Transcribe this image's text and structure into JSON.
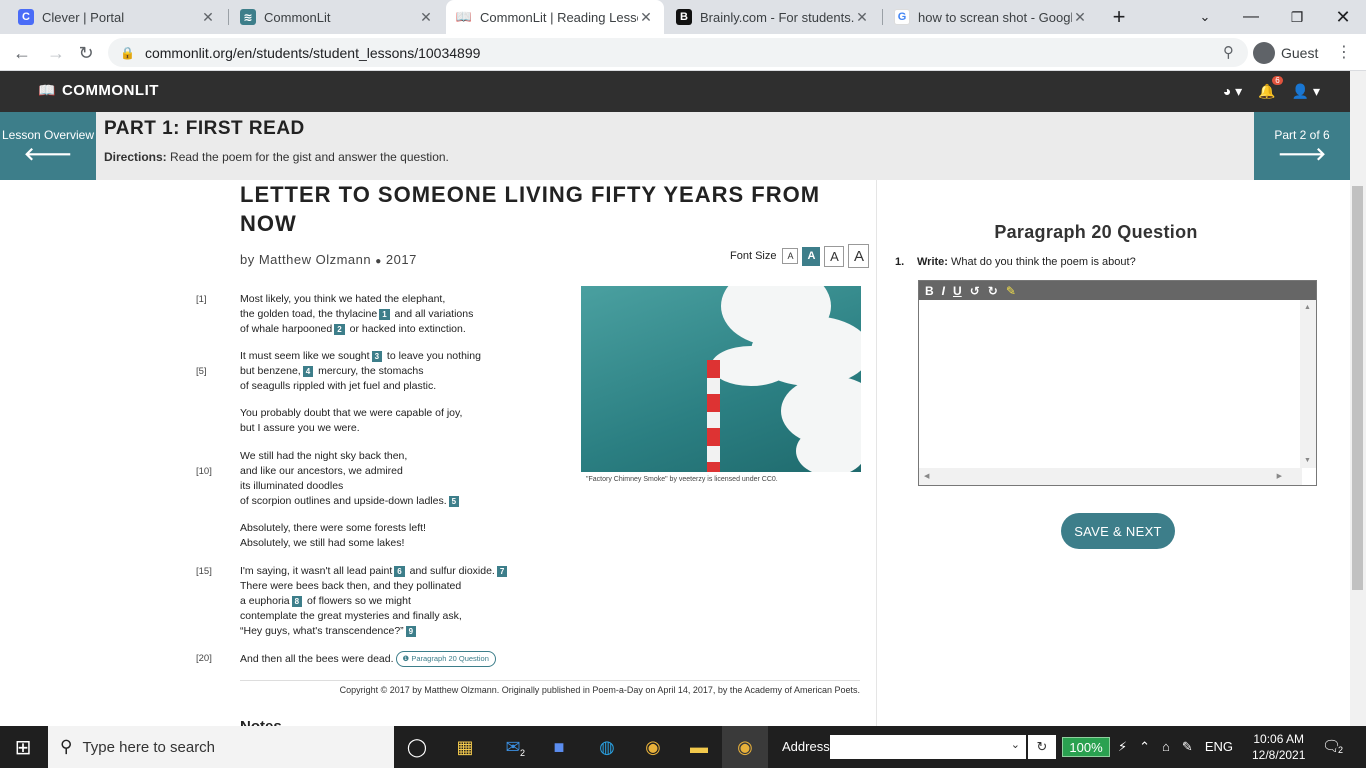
{
  "browser": {
    "tabs": [
      {
        "label": "Clever | Portal",
        "icon": "clever-icon",
        "color": "#4a6cf7"
      },
      {
        "label": "CommonLit",
        "icon": "commonlit-icon",
        "color": "#3d7e8a"
      },
      {
        "label": "CommonLit | Reading Lesson",
        "icon": "book-icon",
        "color": "#202124",
        "active": true
      },
      {
        "label": "Brainly.com - For students. By",
        "icon": "brainly-icon",
        "color": "#111111"
      },
      {
        "label": "how to screan shot - Google S",
        "icon": "google-icon",
        "color": "#4285f4"
      }
    ],
    "url": "commonlit.org/en/students/student_lessons/10034899",
    "profile": "Guest"
  },
  "app": {
    "brand": "COMMONLIT",
    "notification_count": "6"
  },
  "lesson": {
    "overview_label": "Lesson Overview",
    "part_title": "PART 1: FIRST READ",
    "directions_label": "Directions:",
    "directions_text": "Read the poem for the gist and answer the question.",
    "part_progress": "Part 2 of 6"
  },
  "poem": {
    "title": "LETTER TO SOMEONE LIVING FIFTY YEARS FROM NOW",
    "byline": "by Matthew Olzmann",
    "bullet": "●",
    "year": "2017",
    "font_size_label": "Font Size",
    "font_buttons": [
      "A",
      "A",
      "A",
      "A"
    ],
    "line_numbers": [
      "[1]",
      "[5]",
      "[10]",
      "[15]",
      "[20]"
    ],
    "lines": [
      {
        "parts": [
          "Most likely, you think we hated the elephant,"
        ]
      },
      {
        "parts": [
          "the golden toad, the thylacine",
          " and all variations"
        ],
        "fn": [
          "1"
        ]
      },
      {
        "parts": [
          "of whale harpooned",
          " or hacked into extinction."
        ],
        "fn": [
          "2"
        ]
      },
      {
        "parts": [
          "It must seem like we sought",
          " to leave you nothing"
        ],
        "fn": [
          "3"
        ]
      },
      {
        "parts": [
          "but benzene,",
          " mercury, the stomachs"
        ],
        "fn": [
          "4"
        ]
      },
      {
        "parts": [
          "of seagulls rippled with jet fuel and plastic."
        ]
      },
      {
        "parts": [
          "You probably doubt that we were capable of joy,"
        ]
      },
      {
        "parts": [
          "but I assure you we were."
        ]
      },
      {
        "parts": [
          "We still had the night sky back then,"
        ]
      },
      {
        "parts": [
          "and like our ancestors, we admired"
        ]
      },
      {
        "parts": [
          "its illuminated doodles"
        ]
      },
      {
        "parts": [
          "of scorpion outlines and upside-down ladles.",
          ""
        ],
        "fn": [
          "5"
        ]
      },
      {
        "parts": [
          "Absolutely, there were some forests left!"
        ]
      },
      {
        "parts": [
          "Absolutely, we still had some lakes!"
        ]
      },
      {
        "parts": [
          "I'm saying, it wasn't all lead paint",
          " and sulfur dioxide.",
          ""
        ],
        "fn": [
          "6",
          "7"
        ]
      },
      {
        "parts": [
          "There were bees back then, and they pollinated"
        ]
      },
      {
        "parts": [
          "a euphoria",
          " of flowers so we might"
        ],
        "fn": [
          "8"
        ]
      },
      {
        "parts": [
          "contemplate the great mysteries and finally ask,"
        ]
      },
      {
        "parts": [
          "“Hey guys, what's transcendence?”",
          ""
        ],
        "fn": [
          "9"
        ]
      },
      {
        "parts": [
          "And then all the bees were dead."
        ]
      }
    ],
    "question_chip": "Paragraph 20 Question",
    "image_caption": "\"Factory Chimney Smoke\" by veeterzy is licensed under CC0.",
    "copyright": "Copyright © 2017 by Matthew Olzmann. Originally published in Poem-a-Day on April 14, 2017, by the Academy of American Poets.",
    "notes_label": "Notes"
  },
  "question": {
    "title": "Paragraph 20 Question",
    "number": "1.",
    "prompt_label": "Write:",
    "prompt_text": "What do you think the poem is about?",
    "toolbar": [
      "B",
      "I",
      "U",
      "↺",
      "↻",
      "✎"
    ],
    "answer": "",
    "save_label": "SAVE & NEXT"
  },
  "taskbar": {
    "search_placeholder": "Type here to search",
    "mail_badge": "2",
    "address_label": "Address",
    "zoom": "100%",
    "language": "ENG",
    "time": "10:06 AM",
    "date": "12/8/2021",
    "notif_badge": "2"
  }
}
